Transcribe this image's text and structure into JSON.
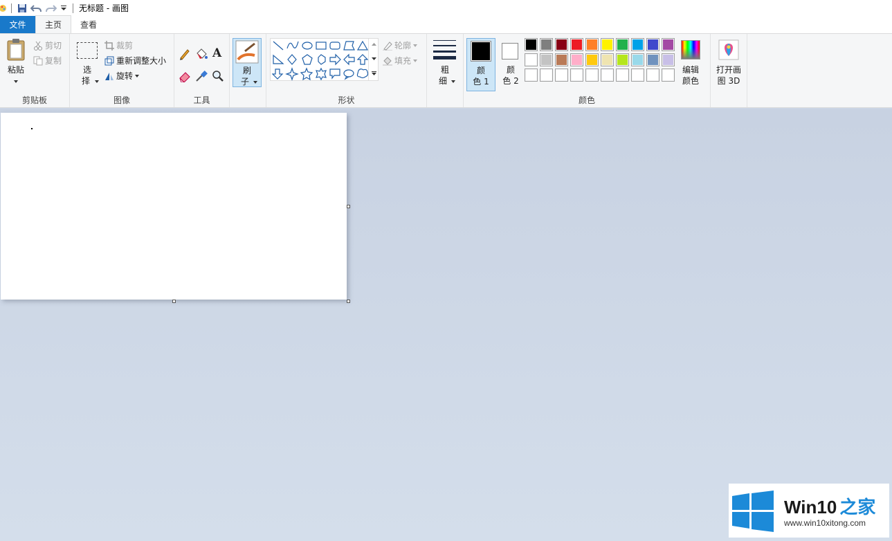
{
  "window": {
    "title": "无标题 - 画图"
  },
  "tabs": {
    "file": "文件",
    "home": "主页",
    "view": "查看"
  },
  "clipboard": {
    "paste": "粘贴",
    "cut": "剪切",
    "copy": "复制",
    "label": "剪贴板"
  },
  "image": {
    "select_1": "选",
    "select_2": "择",
    "crop": "裁剪",
    "resize": "重新调整大小",
    "rotate": "旋转",
    "label": "图像"
  },
  "tools": {
    "label": "工具",
    "text_icon": "A"
  },
  "brushes": {
    "label_1": "刷",
    "label_2": "子"
  },
  "shapes": {
    "outline": "轮廓",
    "fill": "填充",
    "label": "形状"
  },
  "size": {
    "label_1": "粗",
    "label_2": "细"
  },
  "colors": {
    "color1_1": "颜",
    "color1_2": "色 1",
    "color2_1": "颜",
    "color2_2": "色 2",
    "edit_1": "编辑",
    "edit_2": "颜色",
    "label": "颜色",
    "row1": [
      "#000000",
      "#7f7f7f",
      "#880015",
      "#ed1c24",
      "#ff7f27",
      "#fff200",
      "#22b14c",
      "#00a2e8",
      "#3f48cc",
      "#a349a4"
    ],
    "row2": [
      "#ffffff",
      "#c3c3c3",
      "#b97a57",
      "#ffaec9",
      "#ffc90e",
      "#efe4b0",
      "#b5e61d",
      "#99d9ea",
      "#7092be",
      "#c8bfe7"
    ],
    "row3": [
      "#ffffff",
      "#ffffff",
      "#ffffff",
      "#ffffff",
      "#ffffff",
      "#ffffff",
      "#ffffff",
      "#ffffff",
      "#ffffff",
      "#ffffff"
    ],
    "primary": "#000000",
    "secondary": "#ffffff"
  },
  "paint3d": {
    "label_1": "打开画",
    "label_2": "图 3D"
  },
  "watermark": {
    "brand": "Win10",
    "brand_suffix": "之家",
    "url": "www.win10xitong.com"
  }
}
